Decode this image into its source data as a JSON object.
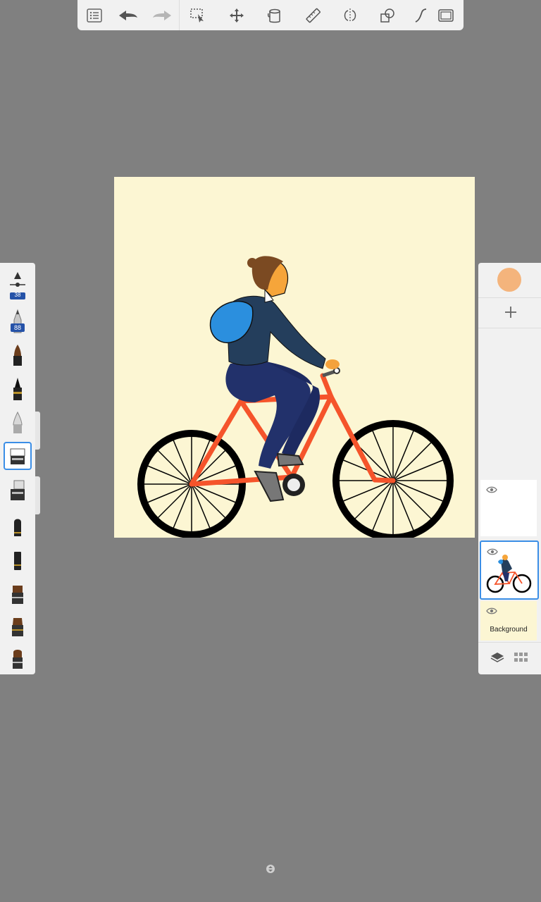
{
  "toolbar": {
    "items": [
      {
        "icon": "list-icon"
      },
      {
        "icon": "undo-icon"
      },
      {
        "icon": "redo-icon"
      },
      {
        "icon": "selection-icon"
      },
      {
        "icon": "transform-icon"
      },
      {
        "icon": "fill-bucket-icon"
      },
      {
        "icon": "ruler-icon"
      },
      {
        "icon": "symmetry-icon"
      },
      {
        "icon": "shapes-icon"
      },
      {
        "icon": "stroke-icon"
      },
      {
        "icon": "fullscreen-icon"
      }
    ]
  },
  "brush_panel": {
    "number_badge_top": "38",
    "number_badge": "88",
    "selected_index": 4
  },
  "layers": {
    "current_color": "#f4b47c",
    "items": [
      {
        "name": "",
        "visible": true
      },
      {
        "name": "",
        "visible": true,
        "selected": true
      },
      {
        "name": "Background",
        "visible": true
      }
    ]
  },
  "colors": {
    "canvas_bg": "#fcf6d3",
    "workspace": "#808080",
    "accent": "#3b8ee6"
  }
}
